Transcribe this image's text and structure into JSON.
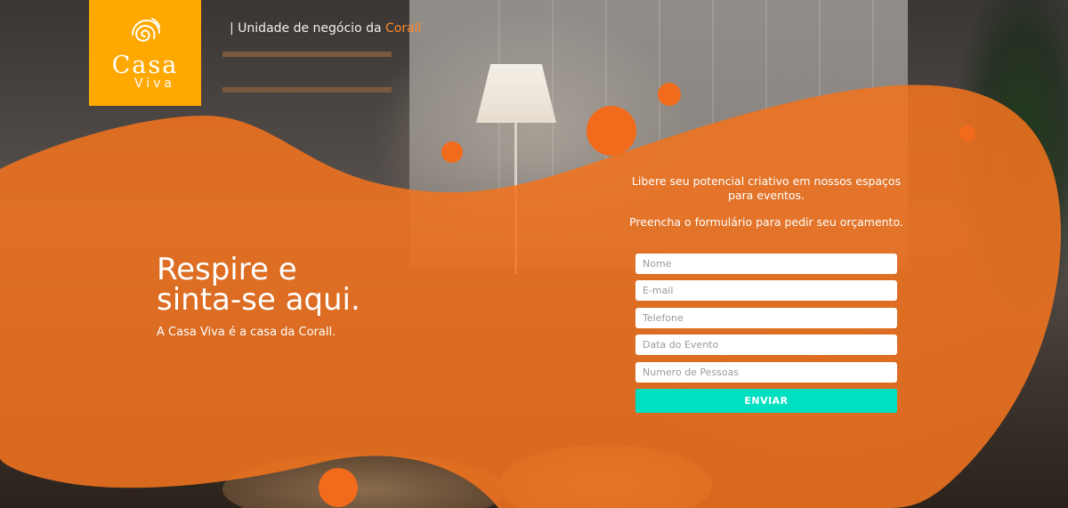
{
  "brand": {
    "logo_word_top": "Casa",
    "logo_word_bottom": "Viva",
    "logo_color": "#ffa800",
    "tagline_prefix": "| Unidade de negócio da ",
    "tagline_brand": "Corall",
    "tagline_brand_color": "#ff8a2a"
  },
  "hero": {
    "title_line1": "Respire e",
    "title_line2": "sinta-se aqui.",
    "subtitle": "A Casa Viva é a casa da Corall."
  },
  "form": {
    "intro_line1": "Libere seu potencial criativo em nossos espaços para eventos.",
    "intro_line2": "Preencha o formulário para pedir seu orçamento.",
    "fields": {
      "name_placeholder": "Nome",
      "email_placeholder": "E-mail",
      "phone_placeholder": "Telefone",
      "date_placeholder": "Data do Evento",
      "people_placeholder": "Numero de Pessoas"
    },
    "submit_label": "ENVIAR",
    "submit_color": "#00dfc0"
  },
  "theme": {
    "overlay_color": "#f0731f",
    "bubble_color": "#f26a1b"
  }
}
